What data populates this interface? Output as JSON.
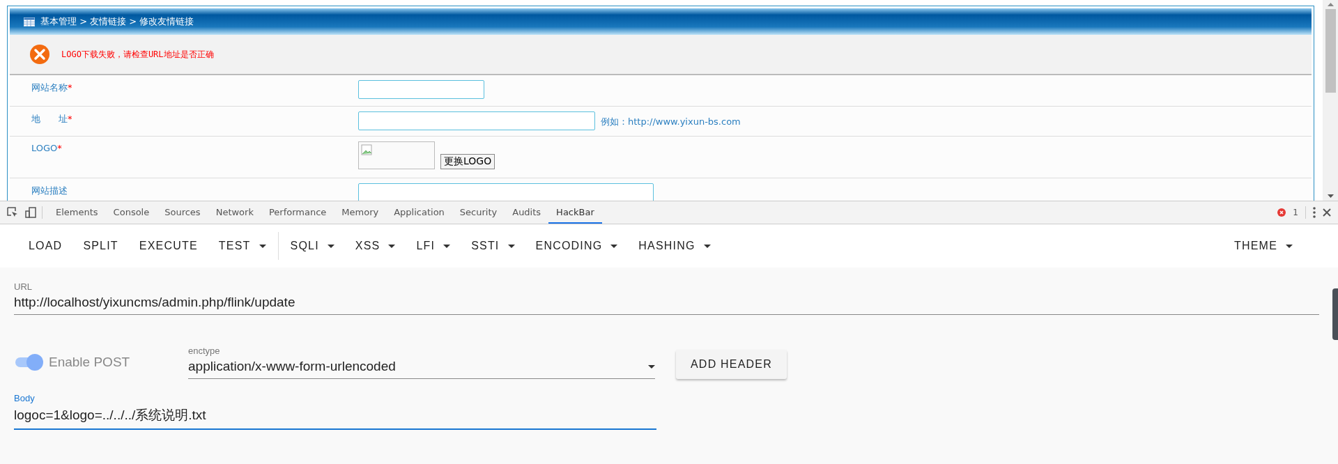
{
  "page": {
    "breadcrumb": "基本管理 > 友情链接 > 修改友情链接",
    "error_message": "LOGO下载失败，请检查URL地址是否正确",
    "fields": [
      {
        "kind": "text",
        "label": "网站名称",
        "required_mark": "*"
      },
      {
        "kind": "text",
        "label": "地　　址",
        "required_mark": "*",
        "hint": "例如：http://www.yixun-bs.com"
      },
      {
        "kind": "logo",
        "label": "LOGO",
        "required_mark": "*",
        "button": "更换LOGO"
      },
      {
        "kind": "text",
        "label": "网站描述"
      }
    ]
  },
  "devtools": {
    "tabs": [
      {
        "label": "Elements",
        "selected": false
      },
      {
        "label": "Console",
        "selected": false
      },
      {
        "label": "Sources",
        "selected": false
      },
      {
        "label": "Network",
        "selected": false
      },
      {
        "label": "Performance",
        "selected": false
      },
      {
        "label": "Memory",
        "selected": false
      },
      {
        "label": "Application",
        "selected": false
      },
      {
        "label": "Security",
        "selected": false
      },
      {
        "label": "Audits",
        "selected": false
      },
      {
        "label": "HackBar",
        "selected": true
      }
    ],
    "error_count": "1"
  },
  "hackbar": {
    "toolbar_groups": [
      [
        {
          "label": "LOAD",
          "dropdown": false
        },
        {
          "label": "SPLIT",
          "dropdown": false
        },
        {
          "label": "EXECUTE",
          "dropdown": false
        },
        {
          "label": "TEST",
          "dropdown": true
        }
      ],
      [
        {
          "label": "SQLI",
          "dropdown": true
        },
        {
          "label": "XSS",
          "dropdown": true
        },
        {
          "label": "LFI",
          "dropdown": true
        },
        {
          "label": "SSTI",
          "dropdown": true
        },
        {
          "label": "ENCODING",
          "dropdown": true
        },
        {
          "label": "HASHING",
          "dropdown": true
        }
      ]
    ],
    "theme": {
      "label": "THEME",
      "dropdown": true
    },
    "url": {
      "label": "URL",
      "value": "http://localhost/yixuncms/admin.php/flink/update"
    },
    "enable_post": {
      "label": "Enable POST",
      "on": true
    },
    "enctype": {
      "label": "enctype",
      "value": "application/x-www-form-urlencoded"
    },
    "add_header": "ADD HEADER",
    "body": {
      "label": "Body",
      "value": "logoc=1&logo=../../../系统说明.txt",
      "focused": true
    }
  }
}
